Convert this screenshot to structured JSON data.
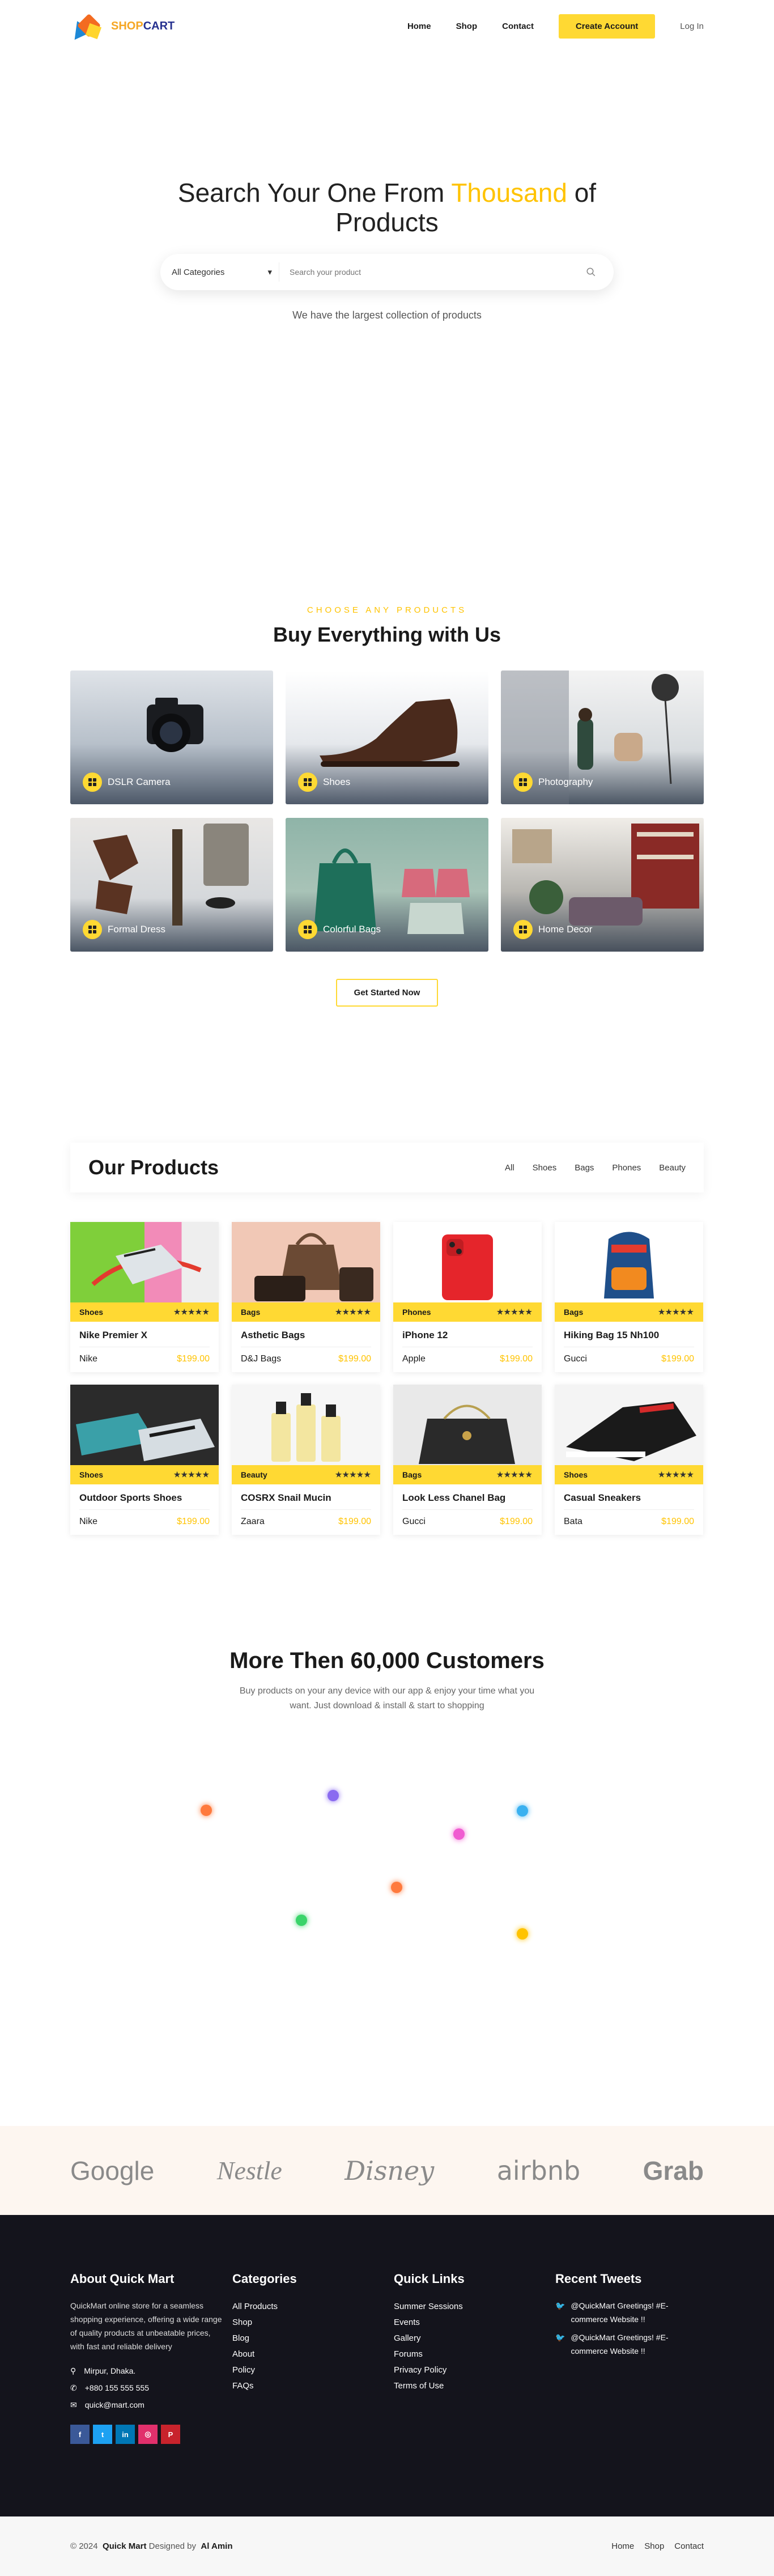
{
  "header": {
    "logo_a": "SHOP",
    "logo_b": "CART",
    "nav": [
      "Home",
      "Shop",
      "Contact"
    ],
    "cta": "Create Account",
    "login": "Log In"
  },
  "hero": {
    "title_1": "Search Your One From ",
    "title_hl": "Thousand",
    "title_2": " of Products",
    "category": "All Categories",
    "placeholder": "Search your product",
    "sub": "We have the largest collection of products"
  },
  "categories": {
    "eyebrow": "CHOOSE ANY PRODUCTS",
    "title": "Buy Everything with Us",
    "items": [
      "DSLR Camera",
      "Shoes",
      "Photography",
      "Formal Dress",
      "Colorful Bags",
      "Home Decor"
    ],
    "button": "Get Started Now"
  },
  "products": {
    "title": "Our Products",
    "tabs": [
      "All",
      "Shoes",
      "Bags",
      "Phones",
      "Beauty"
    ],
    "stars": "★★★★★",
    "items": [
      {
        "cat": "Shoes",
        "name": "Nike Premier X",
        "brand": "Nike",
        "price": "$199.00"
      },
      {
        "cat": "Bags",
        "name": "Asthetic Bags",
        "brand": "D&J Bags",
        "price": "$199.00"
      },
      {
        "cat": "Phones",
        "name": "iPhone 12",
        "brand": "Apple",
        "price": "$199.00"
      },
      {
        "cat": "Bags",
        "name": "Hiking Bag 15 Nh100",
        "brand": "Gucci",
        "price": "$199.00"
      },
      {
        "cat": "Shoes",
        "name": "Outdoor Sports Shoes",
        "brand": "Nike",
        "price": "$199.00"
      },
      {
        "cat": "Beauty",
        "name": "COSRX Snail Mucin",
        "brand": "Zaara",
        "price": "$199.00"
      },
      {
        "cat": "Bags",
        "name": "Look Less Chanel Bag",
        "brand": "Gucci",
        "price": "$199.00"
      },
      {
        "cat": "Shoes",
        "name": "Casual Sneakers",
        "brand": "Bata",
        "price": "$199.00"
      }
    ]
  },
  "customers": {
    "title": "More Then 60,000 Customers",
    "text": "Buy products on your any device with our app & enjoy your time what you want. Just download & install & start to shopping"
  },
  "brands": [
    "Google",
    "Nestle",
    "Disney",
    "airbnb",
    "Grab"
  ],
  "footer": {
    "about_title": "About Quick Mart",
    "about_text": "QuickMart online store for a seamless shopping experience, offering a wide range of quality products at unbeatable prices, with fast and reliable delivery",
    "address": "Mirpur, Dhaka.",
    "phone": "+880 155 555 555",
    "email": "quick@mart.com",
    "categories_title": "Categories",
    "categories": [
      "All Products",
      "Shop",
      "Blog",
      "About",
      "Policy",
      "FAQs"
    ],
    "quick_title": "Quick Links",
    "quick": [
      "Summer Sessions",
      "Events",
      "Gallery",
      "Forums",
      "Privacy Policy",
      "Terms of Use"
    ],
    "tweets_title": "Recent Tweets",
    "tweets": [
      "@QuickMart Greetings! #E-commerce Website !!",
      "@QuickMart Greetings! #E-commerce Website !!"
    ]
  },
  "bottom": {
    "copy": "© 2024",
    "brand": "Quick Mart",
    "designed": "Designed by",
    "author": "Al Amin",
    "links": [
      "Home",
      "Shop",
      "Contact"
    ]
  }
}
